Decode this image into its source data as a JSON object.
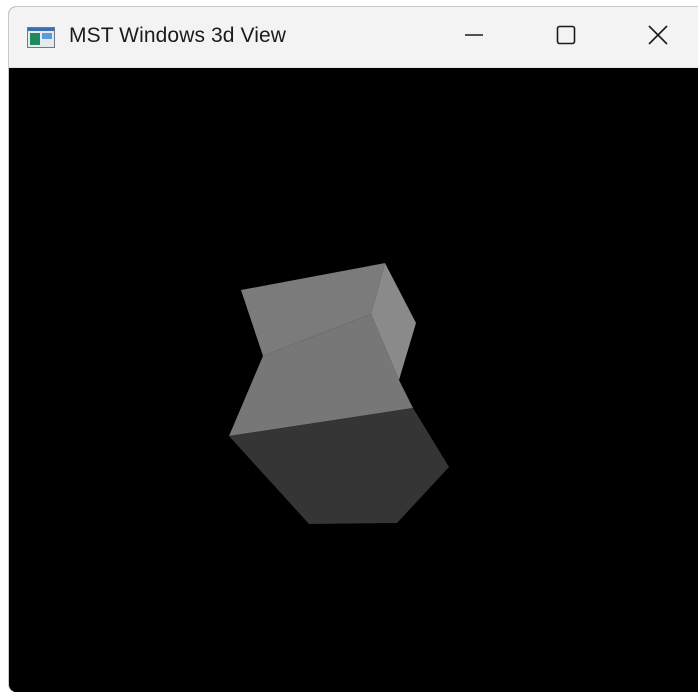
{
  "window": {
    "title": "MST Windows 3d View",
    "controls": {
      "minimize_icon": "minimize-icon",
      "maximize_icon": "maximize-icon",
      "close_icon": "close-icon"
    }
  },
  "viewport": {
    "background": "#000000",
    "object": "shaded 3d shape",
    "face_colors": {
      "top_face": "#7b7b7b",
      "right_face": "#8a8a8a",
      "middle_face": "#777777",
      "bottom_face": "#353535"
    }
  },
  "colors": {
    "titlebar": "#f3f3f3",
    "title_text": "#1b1b1b"
  }
}
